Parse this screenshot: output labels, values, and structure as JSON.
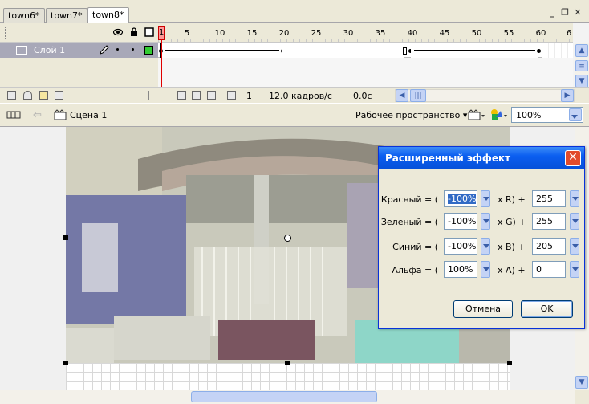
{
  "tabs": [
    {
      "label": "town6*",
      "active": false
    },
    {
      "label": "town7*",
      "active": false
    },
    {
      "label": "town8*",
      "active": true
    }
  ],
  "window_controls": {
    "minimize": "_",
    "restore": "❐",
    "close": "✕"
  },
  "timeline": {
    "ruler_numbers": [
      "1",
      "5",
      "10",
      "15",
      "20",
      "25",
      "30",
      "35",
      "40",
      "45",
      "50",
      "55",
      "60",
      "6"
    ],
    "layer_name": "Слой 1",
    "status": {
      "current_frame": "1",
      "frame_rate": "12.0 кадров/с",
      "elapsed_time": "0.0с"
    }
  },
  "editbar": {
    "scene": "Сцена 1",
    "workspace": "Рабочее пространство",
    "zoom": "100%"
  },
  "dialog": {
    "title": "Расширенный эффект",
    "rows": [
      {
        "label": "Красный = (",
        "percent": "-100%",
        "channel": "x R) +",
        "offset": "255",
        "selected": true
      },
      {
        "label": "Зеленый = (",
        "percent": "-100%",
        "channel": "x G) +",
        "offset": "255",
        "selected": false
      },
      {
        "label": "Синий = (",
        "percent": "-100%",
        "channel": "x B) +",
        "offset": "205",
        "selected": false
      },
      {
        "label": "Альфа = (",
        "percent": "100%",
        "channel": "x A) +",
        "offset": "0",
        "selected": false
      }
    ],
    "cancel_label": "Отмена",
    "ok_label": "OK"
  },
  "colors": {
    "accent": "#0b5ef0",
    "layer_selected": "#a8a8b8",
    "playhead": "#e00000",
    "keyframe_fill": "#33cc33"
  },
  "icons": [
    "eye-icon",
    "lock-icon",
    "outline-icon",
    "pencil-icon",
    "new-layer-icon",
    "motion-guide-icon",
    "folder-icon",
    "trash-icon",
    "scene-icon",
    "back-arrow-icon",
    "edit-symbol-icon",
    "edit-scene-icon"
  ]
}
